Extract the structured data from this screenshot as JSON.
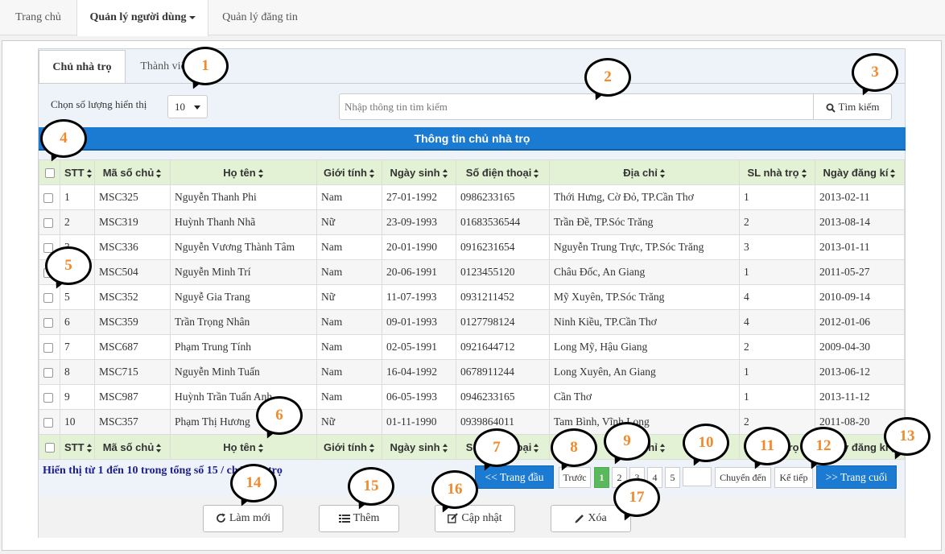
{
  "topnav": {
    "items": [
      "Trang chủ",
      "Quản lý người dùng",
      "Quản lý đăng tin"
    ]
  },
  "tabs": [
    "Chủ nhà trọ",
    "Thành viên"
  ],
  "toolbar": {
    "show_label": "Chọn số lượng hiển thị",
    "show_value": "10",
    "search_placeholder": "Nhập thông tin tìm kiếm",
    "search_button": "Tìm kiếm"
  },
  "banner": "Thông tin chủ nhà trọ",
  "table": {
    "columns": [
      "STT",
      "Mã số chủ",
      "Họ tên",
      "Giới tính",
      "Ngày sinh",
      "Số điện thoại",
      "Địa chỉ",
      "SL nhà trọ",
      "Ngày đăng kí"
    ],
    "rows": [
      [
        "1",
        "MSC325",
        "Nguyễn Thanh Phi",
        "Nam",
        "27-01-1992",
        "0986233165",
        "Thới Hưng, Cờ Đỏ, TP.Cần Thơ",
        "1",
        "2013-02-11"
      ],
      [
        "2",
        "MSC319",
        "Huỳnh Thanh Nhã",
        "Nữ",
        "23-09-1993",
        "01683536544",
        "Trần Đề, TP.Sóc Trăng",
        "2",
        "2013-08-14"
      ],
      [
        "3",
        "MSC336",
        "Nguyễn Vương Thành Tâm",
        "Nam",
        "20-01-1990",
        "0916231654",
        "Nguyễn Trung Trực, TP.Sóc Trăng",
        "3",
        "2013-01-11"
      ],
      [
        "4",
        "MSC504",
        "Nguyễn Minh Trí",
        "Nam",
        "20-06-1991",
        "0123455120",
        "Châu Đốc, An Giang",
        "1",
        "2011-05-27"
      ],
      [
        "5",
        "MSC352",
        "Nguyễ Gia Trang",
        "Nữ",
        "11-07-1993",
        "0931211452",
        "Mỹ Xuyên, TP.Sóc Trăng",
        "4",
        "2010-09-14"
      ],
      [
        "6",
        "MSC359",
        "Trần Trọng Nhân",
        "Nam",
        "09-01-1993",
        "0127798124",
        "Ninh Kiều, TP.Cần Thơ",
        "4",
        "2012-01-06"
      ],
      [
        "7",
        "MSC687",
        "Phạm Trung Tính",
        "Nam",
        "02-05-1991",
        "0921644712",
        "Long Mỹ, Hậu Giang",
        "2",
        "2009-04-30"
      ],
      [
        "8",
        "MSC715",
        "Nguyễn Minh Tuấn",
        "Nam",
        "16-04-1992",
        "0678911244",
        "Long Xuyên, An Giang",
        "1",
        "2013-06-12"
      ],
      [
        "9",
        "MSC987",
        "Huỳnh Trần Tuấn Anh",
        "Nam",
        "06-05-1993",
        "0946233165",
        "Cần Thơ",
        "1",
        "2013-11-12"
      ],
      [
        "10",
        "MSC357",
        "Phạm Thị Hương",
        "Nữ",
        "01-11-1990",
        "0939864011",
        "Tam Bình, Vĩnh Long",
        "2",
        "2011-08-20"
      ]
    ]
  },
  "summary": "Hiển thị từ 1 đến 10 trong tổng số 15 / chủ nhà trọ",
  "pagination": {
    "first": "<< Trang đầu",
    "prev": "Trước",
    "pages": [
      "1",
      "2",
      "3",
      "4",
      "5"
    ],
    "active_page": "1",
    "goto_button": "Chuyển đến",
    "next": "Kế tiếp",
    "last": ">> Trang cuối"
  },
  "actions": {
    "refresh": "Làm mới",
    "add": "Thêm",
    "update": "Cập nhật",
    "delete": "Xóa"
  },
  "callouts": [
    "1",
    "2",
    "3",
    "4",
    "5",
    "6",
    "7",
    "8",
    "9",
    "10",
    "11",
    "12",
    "13",
    "14",
    "15",
    "16",
    "17"
  ],
  "colors": {
    "accent_blue": "#1b7bd3",
    "header_green": "#e3f1d4",
    "active_page_green": "#5cb85c",
    "callout_text": "#f08a2b",
    "summary_text": "#1c1c8c"
  }
}
